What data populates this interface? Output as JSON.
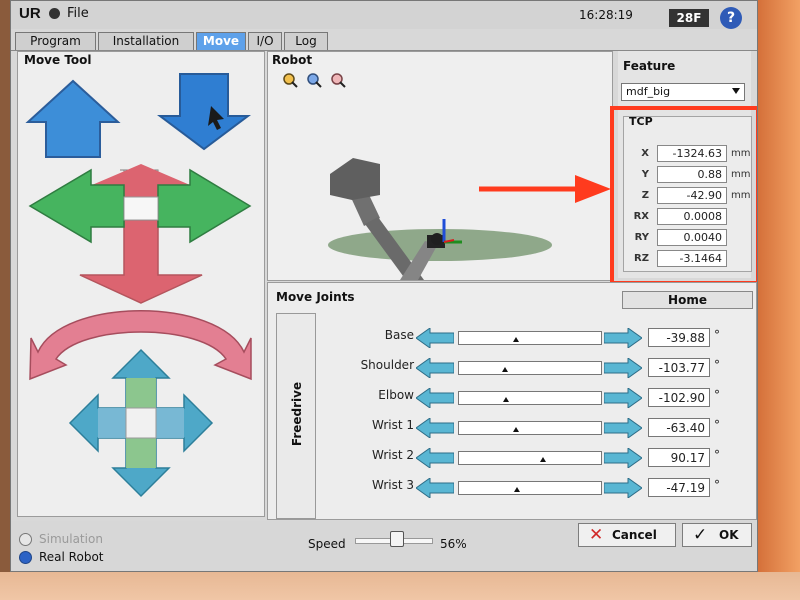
{
  "title_bar": {
    "menu_label": "File",
    "time": "16:28:19",
    "status_badge": "28F",
    "help_symbol": "?"
  },
  "tabs": [
    "Program",
    "Installation",
    "Move",
    "I/O",
    "Log"
  ],
  "active_tab": "Move",
  "move_tool": {
    "title": "Move Tool"
  },
  "robot_view": {
    "title": "Robot"
  },
  "feature": {
    "title": "Feature",
    "selected": "mdf_big"
  },
  "tcp": {
    "title": "TCP",
    "rows": [
      {
        "label": "X",
        "value": "-1324.63",
        "unit": "mm"
      },
      {
        "label": "Y",
        "value": "0.88",
        "unit": "mm"
      },
      {
        "label": "Z",
        "value": "-42.90",
        "unit": "mm"
      },
      {
        "label": "RX",
        "value": "0.0008",
        "unit": ""
      },
      {
        "label": "RY",
        "value": "0.0040",
        "unit": ""
      },
      {
        "label": "RZ",
        "value": "-3.1464",
        "unit": ""
      }
    ]
  },
  "joints": {
    "title": "Move Joints",
    "home_label": "Home",
    "freedrive_label": "Freedrive",
    "rows": [
      {
        "name": "Base",
        "value": "-39.88",
        "unit": "°",
        "slider_fraction": 0.39
      },
      {
        "name": "Shoulder",
        "value": "-103.77",
        "unit": "°",
        "slider_fraction": 0.31
      },
      {
        "name": "Elbow",
        "value": "-102.90",
        "unit": "°",
        "slider_fraction": 0.32
      },
      {
        "name": "Wrist 1",
        "value": "-63.40",
        "unit": "°",
        "slider_fraction": 0.39
      },
      {
        "name": "Wrist 2",
        "value": "90.17",
        "unit": "°",
        "slider_fraction": 0.59
      },
      {
        "name": "Wrist 3",
        "value": "-47.19",
        "unit": "°",
        "slider_fraction": 0.4
      }
    ]
  },
  "bottom": {
    "simulation_label": "Simulation",
    "real_robot_label": "Real Robot",
    "speed_label": "Speed",
    "speed_value": "56%",
    "cancel_label": "Cancel",
    "ok_label": "OK"
  },
  "colors": {
    "tab_active": "#5ea1ea",
    "highlight": "#ff3b1e",
    "arrow_blue": "#3d8ed8",
    "arrow_red": "#d85a6b",
    "arrow_green": "#42b55a",
    "arrow_teal": "#4ea8c8",
    "arrow_pink": "#e38b9f"
  }
}
